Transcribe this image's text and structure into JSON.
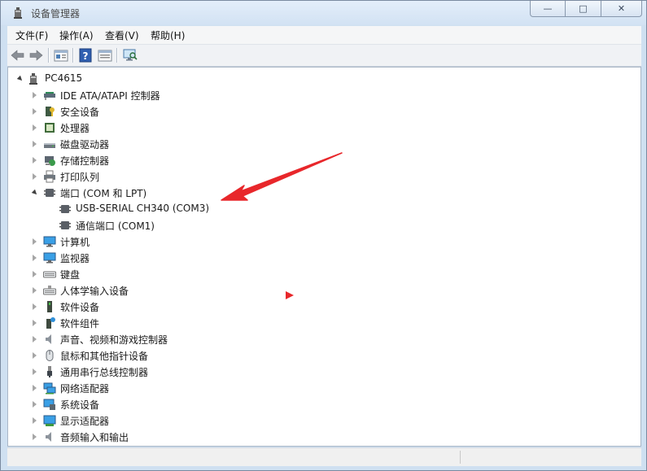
{
  "window": {
    "title": "设备管理器",
    "controls": {
      "minimize": "—",
      "maximize": "□",
      "close": "✕"
    }
  },
  "menubar": {
    "items": [
      {
        "label": "文件(F)"
      },
      {
        "label": "操作(A)"
      },
      {
        "label": "查看(V)"
      },
      {
        "label": "帮助(H)"
      }
    ]
  },
  "toolbar": {
    "buttons": [
      "back-arrow-icon",
      "forward-arrow-icon",
      "properties-icon",
      "help-icon",
      "show-hidden-icon",
      "scan-hardware-icon"
    ]
  },
  "tree": {
    "root": {
      "label": "PC4615",
      "icon": "computer-tower-icon"
    },
    "categories": [
      {
        "label": "IDE ATA/ATAPI 控制器",
        "icon": "ide-controller-icon",
        "expanded": false
      },
      {
        "label": "安全设备",
        "icon": "security-device-icon",
        "expanded": false
      },
      {
        "label": "处理器",
        "icon": "processor-icon",
        "expanded": false
      },
      {
        "label": "磁盘驱动器",
        "icon": "disk-drive-icon",
        "expanded": false
      },
      {
        "label": "存储控制器",
        "icon": "storage-controller-icon",
        "expanded": false
      },
      {
        "label": "打印队列",
        "icon": "printer-icon",
        "expanded": false
      },
      {
        "label": "端口 (COM 和 LPT)",
        "icon": "port-icon",
        "expanded": true,
        "children": [
          {
            "label": "USB-SERIAL CH340 (COM3)",
            "icon": "port-icon"
          },
          {
            "label": "通信端口 (COM1)",
            "icon": "port-icon"
          }
        ]
      },
      {
        "label": "计算机",
        "icon": "monitor-icon",
        "expanded": false
      },
      {
        "label": "监视器",
        "icon": "monitor-icon",
        "expanded": false
      },
      {
        "label": "键盘",
        "icon": "keyboard-icon",
        "expanded": false
      },
      {
        "label": "人体学输入设备",
        "icon": "hid-icon",
        "expanded": false
      },
      {
        "label": "软件设备",
        "icon": "software-device-icon",
        "expanded": false
      },
      {
        "label": "软件组件",
        "icon": "software-component-icon",
        "expanded": false
      },
      {
        "label": "声音、视频和游戏控制器",
        "icon": "speaker-icon",
        "expanded": false
      },
      {
        "label": "鼠标和其他指针设备",
        "icon": "mouse-icon",
        "expanded": false
      },
      {
        "label": "通用串行总线控制器",
        "icon": "usb-icon",
        "expanded": false
      },
      {
        "label": "网络适配器",
        "icon": "network-adapter-icon",
        "expanded": false
      },
      {
        "label": "系统设备",
        "icon": "system-device-icon",
        "expanded": false
      },
      {
        "label": "显示适配器",
        "icon": "display-adapter-icon",
        "expanded": false
      },
      {
        "label": "音频输入和输出",
        "icon": "audio-io-icon",
        "expanded": false
      }
    ]
  },
  "annotation": {
    "color": "#e8272b"
  }
}
